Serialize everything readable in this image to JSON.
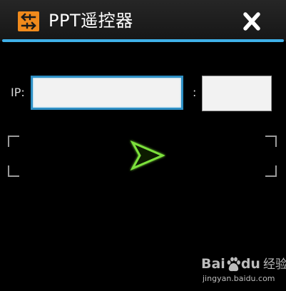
{
  "window": {
    "title": "PPT遥控器"
  },
  "connection": {
    "ip_label": "IP:",
    "ip_value": "",
    "port_separator": ":",
    "port_value": ""
  },
  "watermark": {
    "brand_left": "Bai",
    "brand_right": "du",
    "brand_suffix": "经验",
    "url": "jingyan.baidu.com"
  },
  "colors": {
    "accent_bar": "#3fb0e8",
    "app_icon": "#f08a1c",
    "send_arrow": "#7be03a"
  },
  "icons": {
    "app": "swap-arrows-icon",
    "close": "close-icon",
    "send": "send-arrow-icon"
  }
}
